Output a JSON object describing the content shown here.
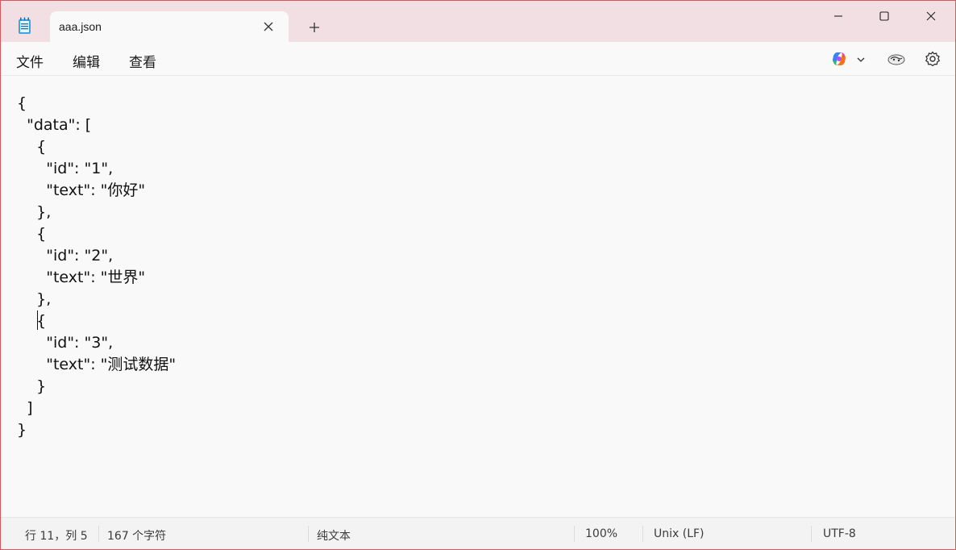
{
  "tab": {
    "title": "aaa.json"
  },
  "menu": {
    "file": "文件",
    "edit": "编辑",
    "view": "查看"
  },
  "editor": {
    "lines": [
      "{",
      "  \"data\": [",
      "    {",
      "      \"id\": \"1\",",
      "      \"text\": \"你好\"",
      "    },",
      "    {",
      "      \"id\": \"2\",",
      "      \"text\": \"世界\"",
      "    },",
      "    {",
      "      \"id\": \"3\",",
      "      \"text\": \"测试数据\"",
      "    }",
      "  ]",
      "}"
    ]
  },
  "status": {
    "position": "行 11，列 5",
    "chars": "167 个字符",
    "format": "纯文本",
    "zoom": "100%",
    "line_ending": "Unix (LF)",
    "encoding": "UTF-8"
  },
  "colors": {
    "accent_border": "#d9565d",
    "titlebar": "#f1dfe3"
  },
  "icons": {
    "app": "notepad-icon",
    "close_tab": "close-icon",
    "new_tab": "plus-icon",
    "minimize": "minimize-icon",
    "maximize": "maximize-icon",
    "close": "close-icon",
    "copilot": "copilot-icon",
    "profile": "profile-icon",
    "settings": "gear-icon"
  }
}
